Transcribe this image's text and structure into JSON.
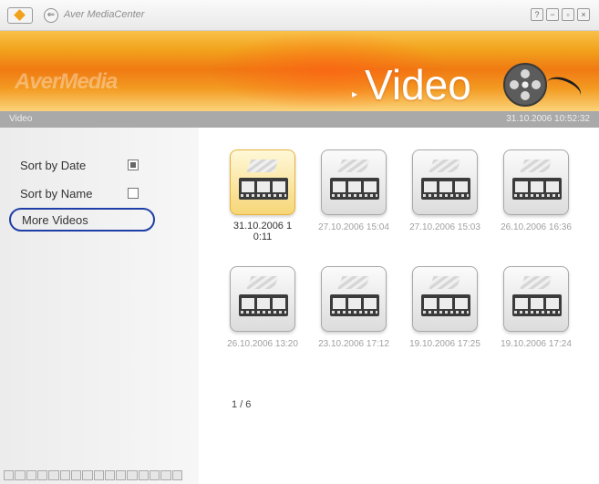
{
  "titlebar": {
    "app_title": "Aver MediaCenter",
    "back_label": "⇐",
    "buttons": [
      "?",
      "−",
      "▫",
      "×"
    ]
  },
  "banner": {
    "brand": "AverMedia",
    "section_title": "Video",
    "icon": "film-reel-icon"
  },
  "status": {
    "label": "Video",
    "datetime": "31.10.2006 10:52:32"
  },
  "sidebar": {
    "sort_by_date": "Sort by Date",
    "sort_by_date_checked": true,
    "sort_by_name": "Sort by Name",
    "sort_by_name_checked": false,
    "more_videos": "More Videos"
  },
  "videos": [
    {
      "date": "31.10.2006 1 0:11",
      "selected": true
    },
    {
      "date": "27.10.2006 15:04",
      "selected": false
    },
    {
      "date": "27.10.2006 15:03",
      "selected": false
    },
    {
      "date": "26.10.2006 16:36",
      "selected": false
    },
    {
      "date": "26.10.2006 13:20",
      "selected": false
    },
    {
      "date": "23.10.2006 17:12",
      "selected": false
    },
    {
      "date": "19.10.2006 17:25",
      "selected": false
    },
    {
      "date": "19.10.2006 17:24",
      "selected": false
    }
  ],
  "pagination": "1 / 6",
  "colors": {
    "accent": "#f07a12",
    "selection_ring": "#1f3fa6",
    "status_bar": "#a9a9a9"
  }
}
